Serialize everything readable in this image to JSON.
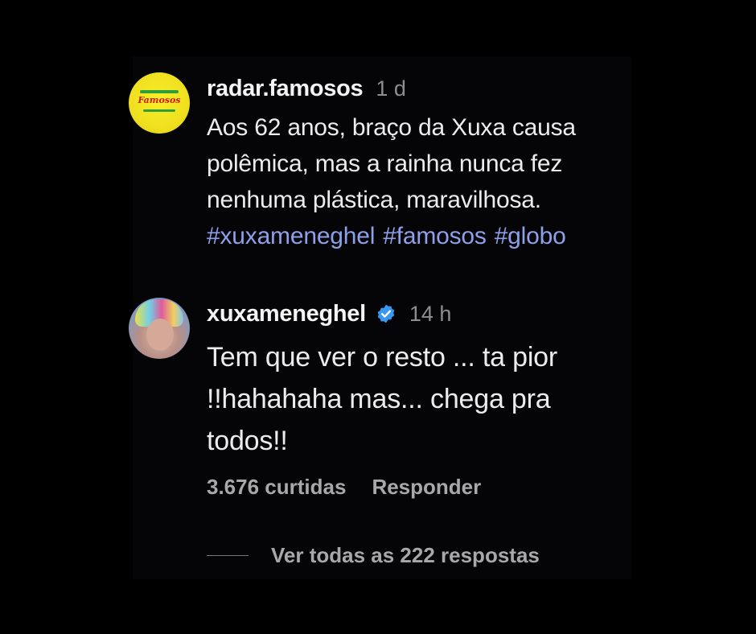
{
  "colors": {
    "background": "#000000",
    "panel": "#050507",
    "text": "#ececec",
    "muted": "#8e8e8e",
    "hashtag": "#8ea0ea",
    "verified": "#3897f0"
  },
  "comments": [
    {
      "username": "radar.famosos",
      "time": "1 d",
      "text": "Aos 62 anos, braço da Xuxa causa\npolêmica, mas a rainha nunca fez\nnenhuma plástica, maravilhosa.",
      "hashtags": [
        "#xuxameneghel",
        "#famosos",
        "#globo"
      ],
      "avatar_icon": "radar-famosos-logo"
    },
    {
      "username": "xuxameneghel",
      "verified": true,
      "verified_icon": "verified-badge-icon",
      "time": "14 h",
      "text": "Tem que ver o resto ... ta pior\n!!hahahaha mas... chega pra\ntodos!!",
      "avatar_icon": "profile-photo",
      "likes": "3.676 curtidas",
      "reply_label": "Responder"
    }
  ],
  "view_replies": "Ver todas as 222 respostas"
}
